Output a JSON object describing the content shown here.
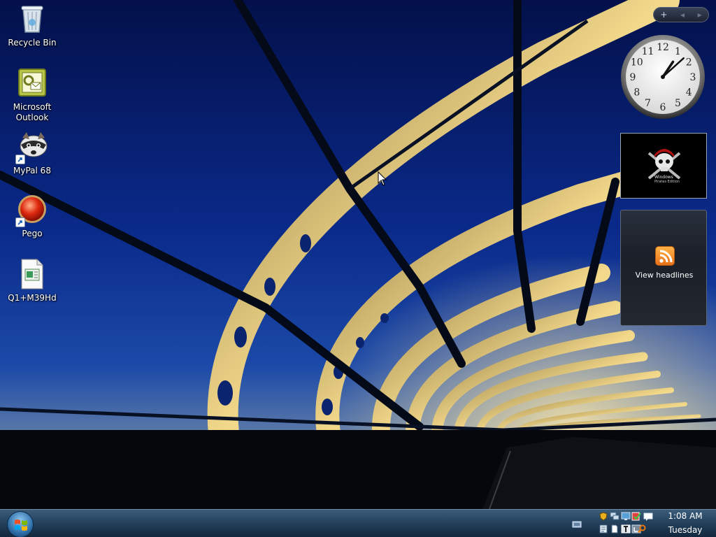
{
  "desktop": {
    "icons": [
      {
        "label_line1": "Recycle Bin",
        "label_line2": ""
      },
      {
        "label_line1": "Microsoft",
        "label_line2": "Outlook"
      },
      {
        "label_line1": "MyPal 68",
        "label_line2": ""
      },
      {
        "label_line1": "Pego",
        "label_line2": ""
      },
      {
        "label_line1": "Q1+M39Hd",
        "label_line2": ""
      }
    ]
  },
  "sidebar": {
    "toolbar": {
      "add": "+",
      "prev": "◂",
      "next": "▸"
    },
    "clock": {
      "numerals": [
        "12",
        "1",
        "2",
        "3",
        "4",
        "5",
        "6",
        "7",
        "8",
        "9",
        "10",
        "11"
      ],
      "hour": 1,
      "minute": 8
    },
    "slideshow": {
      "caption_line1": "Windows",
      "caption_line2": "Pirates Edition"
    },
    "feed": {
      "label": "View headlines"
    }
  },
  "taskbar": {
    "time": "1:08 AM",
    "day": "Tuesday"
  },
  "colors": {
    "taskbar": "#24425e",
    "accent": "#2f6ea8",
    "rss": "#e8701a"
  }
}
